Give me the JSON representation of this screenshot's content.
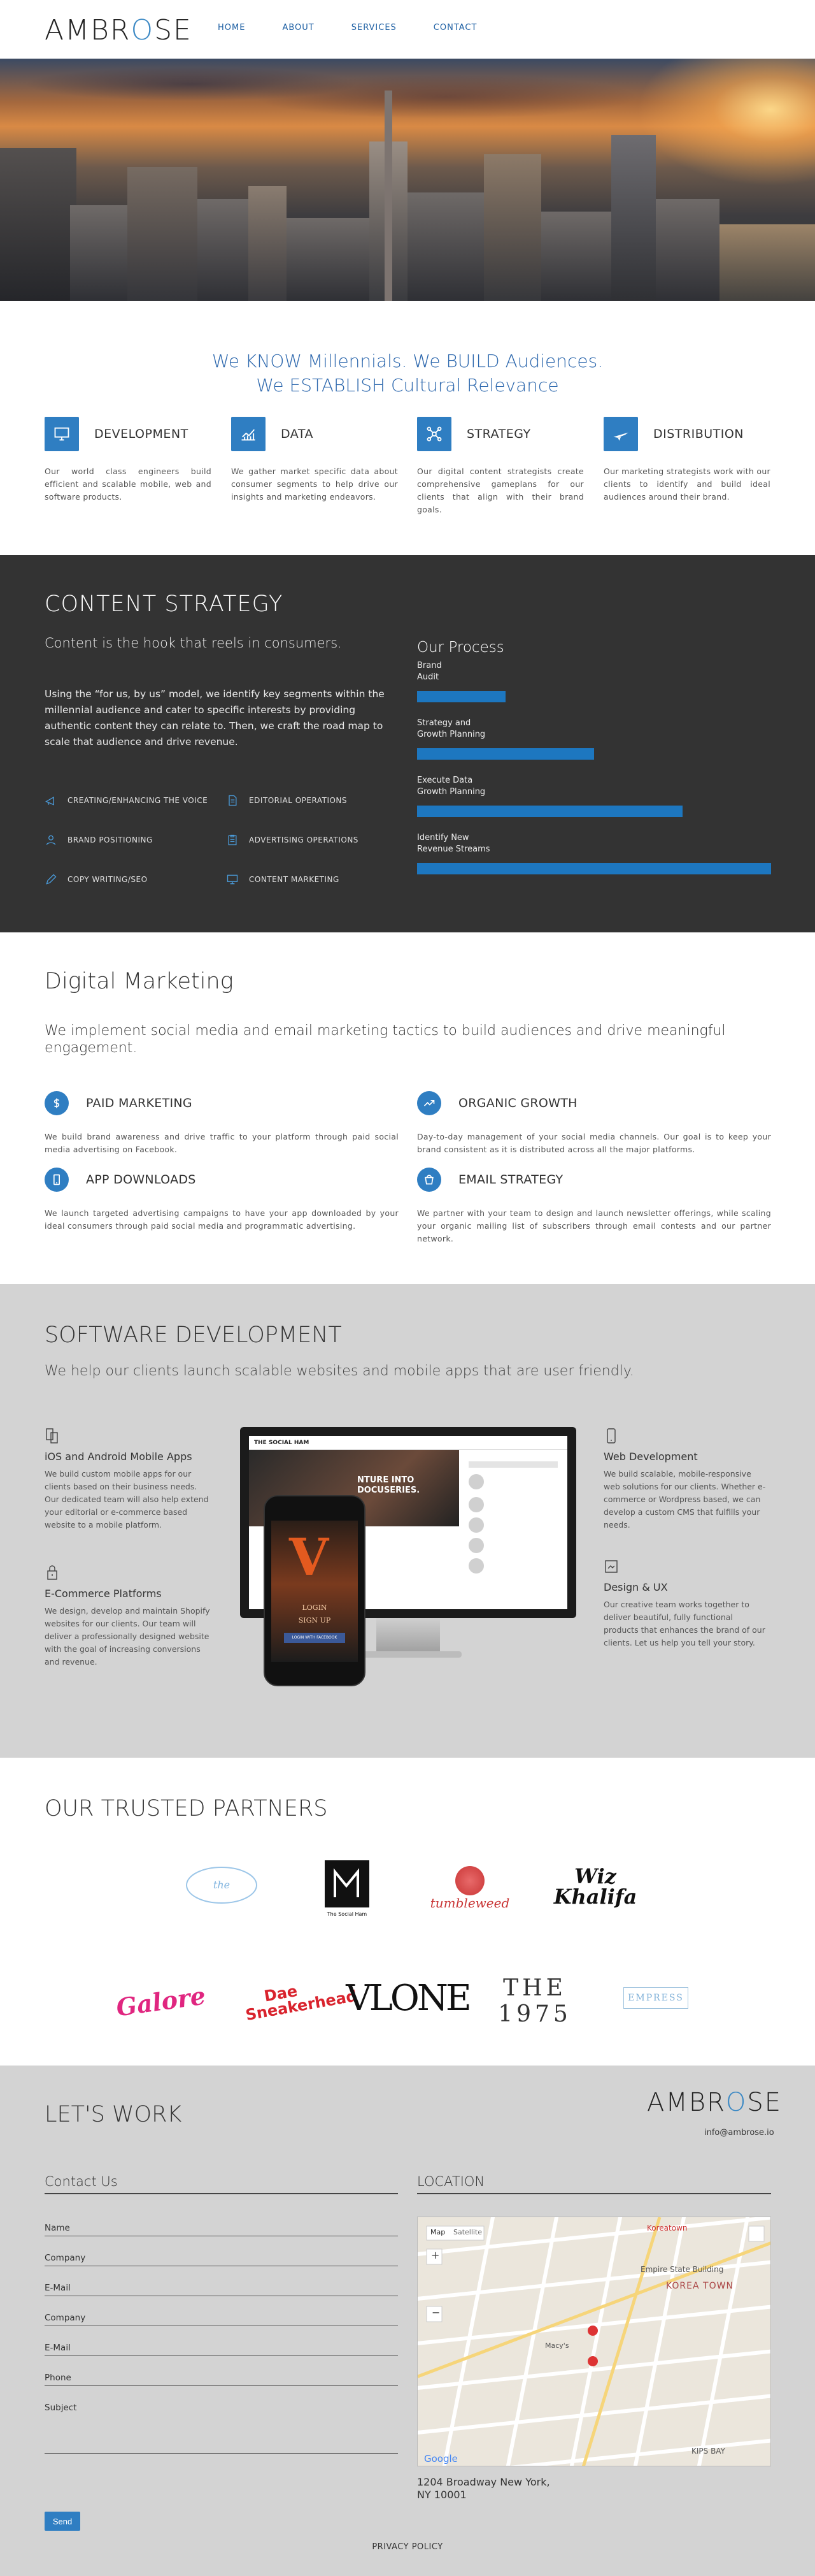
{
  "nav": {
    "logo_left": "AMBR",
    "logo_o": "O",
    "logo_right": "SE",
    "items": [
      "HOME",
      "ABOUT",
      "SERVICES",
      "CONTACT"
    ]
  },
  "tagline": {
    "line1": "We KNOW Millennials. We BUILD Audiences.",
    "line2": "We ESTABLISH Cultural Relevance"
  },
  "services": [
    {
      "title": "DEVELOPMENT",
      "icon": "monitor-icon",
      "desc": "Our world class engineers build efficient and scalable mobile, web and software products."
    },
    {
      "title": "DATA",
      "icon": "chart-icon",
      "desc": "We gather market specific data about consumer segments to help drive our insights and marketing endeavors."
    },
    {
      "title": "STRATEGY",
      "icon": "network-icon",
      "desc": "Our digital content strategists create comprehensive gameplans for our clients that align with their brand goals."
    },
    {
      "title": "DISTRIBUTION",
      "icon": "plane-icon",
      "desc": "Our marketing strategists work with our clients to identify and build ideal audiences around their brand."
    }
  ],
  "content_strategy": {
    "title": "CONTENT STRATEGY",
    "lead": "Content is the hook that reels in consumers.",
    "body": "Using the “for us, by us” model, we identify key segments within the millennial audience and cater to specific interests by providing authentic content they can relate to. Then, we craft the road map to scale that audience and drive revenue.",
    "items_left": [
      "CREATING/ENHANCING THE VOICE",
      "BRAND POSITIONING",
      "COPY WRITING/SEO"
    ],
    "items_right": [
      "EDITORIAL OPERATIONS",
      "ADVERTISING OPERATIONS",
      "CONTENT MARKETING"
    ],
    "process_title": "Our Process",
    "process": [
      {
        "l1": "Brand",
        "l2": "Audit",
        "level": 0.25
      },
      {
        "l1": "Strategy and",
        "l2": "Growth Planning",
        "level": 0.5
      },
      {
        "l1": "Execute Data",
        "l2": "Growth Planning",
        "level": 0.75
      },
      {
        "l1": "Identify New",
        "l2": "Revenue Streams",
        "level": 1.0
      }
    ]
  },
  "digital_marketing": {
    "title": "Digital Marketing",
    "lead": "We implement social media and email marketing tactics to build audiences and drive meaningful engagement.",
    "items": [
      {
        "title": "PAID MARKETING",
        "icon": "dollar-icon",
        "desc": "We build brand awareness and drive traffic to your platform through paid social media advertising on Facebook."
      },
      {
        "title": "ORGANIC GROWTH",
        "icon": "trend-icon",
        "desc": "Day-to-day management of your social media channels. Our goal is to keep your brand consistent as it is distributed across all the major platforms."
      },
      {
        "title": "APP DOWNLOADS",
        "icon": "phone-icon",
        "desc": "We launch targeted advertising campaigns to have your app downloaded by your ideal consumers through paid social media and programmatic advertising."
      },
      {
        "title": "EMAIL STRATEGY",
        "icon": "mail-icon",
        "desc": "We partner with your team to design and launch newsletter offerings, while scaling your organic mailing list of subscribers through email contests and our partner network."
      }
    ]
  },
  "software": {
    "title": "SOFTWARE DEVELOPMENT",
    "lead": "We help our clients launch scalable websites and mobile apps that are user friendly.",
    "items": [
      {
        "title": "iOS and Android Mobile Apps",
        "desc": "We build custom mobile apps for our clients based on their business needs. Our dedicated team will also help extend your editorial or e-commerce based website to a mobile platform."
      },
      {
        "title": "E-Commerce Platforms",
        "desc": "We design, develop and maintain Shopify websites for our clients. Our team will deliver a professionally designed website with the goal of increasing conversions and revenue."
      },
      {
        "title": "Web Development",
        "desc": "We build scalable, mobile-responsive web solutions for our clients. Whether e-commerce or Wordpress based, we can develop a custom CMS that fulfills your needs."
      },
      {
        "title": "Design & UX",
        "desc": "Our creative team works together to deliver beautiful, fully functional products that enhances the brand of our clients. Let us help you tell your story."
      }
    ],
    "mock": {
      "site_name": "THE SOCIAL HAM",
      "headline": "NTURE INTO DOCUSERIES.",
      "login": "LOGIN",
      "signup": "SIGN UP",
      "fb": "LOGIN WITH FACEBOOK"
    }
  },
  "partners": {
    "title": "OUR TRUSTED PARTNERS",
    "logos": [
      "The Social Ham",
      "tumbleweed",
      "Wiz Khalifa",
      "Galore",
      "Dae Sneakerhead",
      "VLONE",
      "THE 1975",
      "EMPRESS"
    ]
  },
  "contact": {
    "title": "LET'S WORK",
    "logo_left": "AMBR",
    "logo_o": "O",
    "logo_right": "SE",
    "email": "info@ambrose.io",
    "form_title": "Contact Us",
    "fields": [
      "Name",
      "Company",
      "E-Mail",
      "Company",
      "E-Mail",
      "Phone",
      "Subject"
    ],
    "send": "Send",
    "location_title": "LOCATION",
    "map_labels": {
      "map": "Map",
      "satellite": "Satellite",
      "k1": "Koreatown",
      "k2": "KOREA TOWN",
      "esb": "Empire State Building",
      "macys": "Macy's",
      "google": "Google",
      "kips": "KIPS BAY"
    },
    "addr1": "1204 Broadway New York,",
    "addr2": "NY 10001",
    "privacy": "PRIVACY POLICY"
  }
}
